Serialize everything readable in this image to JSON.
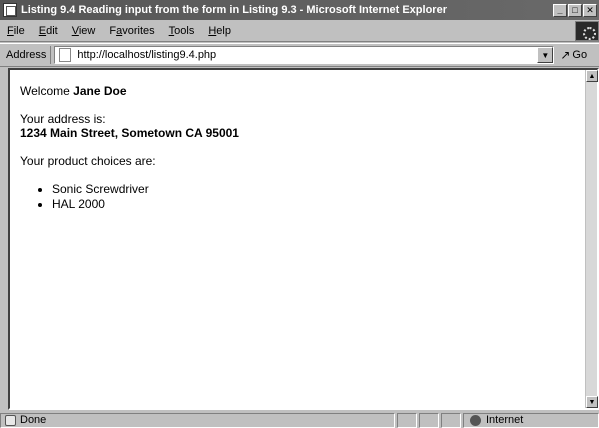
{
  "window": {
    "title": "Listing 9.4 Reading input from the form in Listing 9.3 - Microsoft Internet Explorer"
  },
  "menu": [
    {
      "label": "File",
      "underline": "F",
      "rest": "ile"
    },
    {
      "label": "Edit",
      "underline": "E",
      "rest": "dit"
    },
    {
      "label": "View",
      "underline": "V",
      "rest": "iew"
    },
    {
      "label": "Favorites",
      "underline": "a",
      "prefix": "F",
      "rest": "vorites"
    },
    {
      "label": "Tools",
      "underline": "T",
      "rest": "ools"
    },
    {
      "label": "Help",
      "underline": "H",
      "rest": "elp"
    }
  ],
  "address": {
    "label": "Address",
    "url": "http://localhost/listing9.4.php",
    "go_label": "Go"
  },
  "page": {
    "welcome_prefix": "Welcome ",
    "welcome_name": "Jane Doe",
    "address_intro": "Your address is:",
    "address_value": "1234 Main Street, Sometown CA 95001",
    "products_intro": "Your product choices are:",
    "products": [
      "Sonic Screwdriver",
      "HAL 2000"
    ]
  },
  "status": {
    "text": "Done",
    "zone": "Internet"
  }
}
